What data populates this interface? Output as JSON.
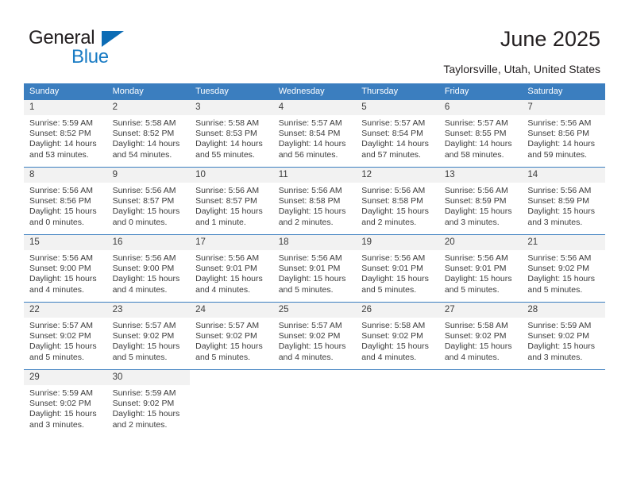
{
  "brand": {
    "name_top": "General",
    "name_bottom": "Blue",
    "accent_color": "#1a7cc4",
    "triangle_color": "#0c6cb5"
  },
  "header": {
    "title": "June 2025",
    "subtitle": "Taylorsville, Utah, United States",
    "header_bg": "#3b7ebf",
    "header_text_color": "#ffffff",
    "daynum_bg": "#f2f2f2"
  },
  "weekdays": [
    "Sunday",
    "Monday",
    "Tuesday",
    "Wednesday",
    "Thursday",
    "Friday",
    "Saturday"
  ],
  "weeks": [
    [
      {
        "day": "1",
        "sunrise": "Sunrise: 5:59 AM",
        "sunset": "Sunset: 8:52 PM",
        "daylight": "Daylight: 14 hours and 53 minutes."
      },
      {
        "day": "2",
        "sunrise": "Sunrise: 5:58 AM",
        "sunset": "Sunset: 8:52 PM",
        "daylight": "Daylight: 14 hours and 54 minutes."
      },
      {
        "day": "3",
        "sunrise": "Sunrise: 5:58 AM",
        "sunset": "Sunset: 8:53 PM",
        "daylight": "Daylight: 14 hours and 55 minutes."
      },
      {
        "day": "4",
        "sunrise": "Sunrise: 5:57 AM",
        "sunset": "Sunset: 8:54 PM",
        "daylight": "Daylight: 14 hours and 56 minutes."
      },
      {
        "day": "5",
        "sunrise": "Sunrise: 5:57 AM",
        "sunset": "Sunset: 8:54 PM",
        "daylight": "Daylight: 14 hours and 57 minutes."
      },
      {
        "day": "6",
        "sunrise": "Sunrise: 5:57 AM",
        "sunset": "Sunset: 8:55 PM",
        "daylight": "Daylight: 14 hours and 58 minutes."
      },
      {
        "day": "7",
        "sunrise": "Sunrise: 5:56 AM",
        "sunset": "Sunset: 8:56 PM",
        "daylight": "Daylight: 14 hours and 59 minutes."
      }
    ],
    [
      {
        "day": "8",
        "sunrise": "Sunrise: 5:56 AM",
        "sunset": "Sunset: 8:56 PM",
        "daylight": "Daylight: 15 hours and 0 minutes."
      },
      {
        "day": "9",
        "sunrise": "Sunrise: 5:56 AM",
        "sunset": "Sunset: 8:57 PM",
        "daylight": "Daylight: 15 hours and 0 minutes."
      },
      {
        "day": "10",
        "sunrise": "Sunrise: 5:56 AM",
        "sunset": "Sunset: 8:57 PM",
        "daylight": "Daylight: 15 hours and 1 minute."
      },
      {
        "day": "11",
        "sunrise": "Sunrise: 5:56 AM",
        "sunset": "Sunset: 8:58 PM",
        "daylight": "Daylight: 15 hours and 2 minutes."
      },
      {
        "day": "12",
        "sunrise": "Sunrise: 5:56 AM",
        "sunset": "Sunset: 8:58 PM",
        "daylight": "Daylight: 15 hours and 2 minutes."
      },
      {
        "day": "13",
        "sunrise": "Sunrise: 5:56 AM",
        "sunset": "Sunset: 8:59 PM",
        "daylight": "Daylight: 15 hours and 3 minutes."
      },
      {
        "day": "14",
        "sunrise": "Sunrise: 5:56 AM",
        "sunset": "Sunset: 8:59 PM",
        "daylight": "Daylight: 15 hours and 3 minutes."
      }
    ],
    [
      {
        "day": "15",
        "sunrise": "Sunrise: 5:56 AM",
        "sunset": "Sunset: 9:00 PM",
        "daylight": "Daylight: 15 hours and 4 minutes."
      },
      {
        "day": "16",
        "sunrise": "Sunrise: 5:56 AM",
        "sunset": "Sunset: 9:00 PM",
        "daylight": "Daylight: 15 hours and 4 minutes."
      },
      {
        "day": "17",
        "sunrise": "Sunrise: 5:56 AM",
        "sunset": "Sunset: 9:01 PM",
        "daylight": "Daylight: 15 hours and 4 minutes."
      },
      {
        "day": "18",
        "sunrise": "Sunrise: 5:56 AM",
        "sunset": "Sunset: 9:01 PM",
        "daylight": "Daylight: 15 hours and 5 minutes."
      },
      {
        "day": "19",
        "sunrise": "Sunrise: 5:56 AM",
        "sunset": "Sunset: 9:01 PM",
        "daylight": "Daylight: 15 hours and 5 minutes."
      },
      {
        "day": "20",
        "sunrise": "Sunrise: 5:56 AM",
        "sunset": "Sunset: 9:01 PM",
        "daylight": "Daylight: 15 hours and 5 minutes."
      },
      {
        "day": "21",
        "sunrise": "Sunrise: 5:56 AM",
        "sunset": "Sunset: 9:02 PM",
        "daylight": "Daylight: 15 hours and 5 minutes."
      }
    ],
    [
      {
        "day": "22",
        "sunrise": "Sunrise: 5:57 AM",
        "sunset": "Sunset: 9:02 PM",
        "daylight": "Daylight: 15 hours and 5 minutes."
      },
      {
        "day": "23",
        "sunrise": "Sunrise: 5:57 AM",
        "sunset": "Sunset: 9:02 PM",
        "daylight": "Daylight: 15 hours and 5 minutes."
      },
      {
        "day": "24",
        "sunrise": "Sunrise: 5:57 AM",
        "sunset": "Sunset: 9:02 PM",
        "daylight": "Daylight: 15 hours and 5 minutes."
      },
      {
        "day": "25",
        "sunrise": "Sunrise: 5:57 AM",
        "sunset": "Sunset: 9:02 PM",
        "daylight": "Daylight: 15 hours and 4 minutes."
      },
      {
        "day": "26",
        "sunrise": "Sunrise: 5:58 AM",
        "sunset": "Sunset: 9:02 PM",
        "daylight": "Daylight: 15 hours and 4 minutes."
      },
      {
        "day": "27",
        "sunrise": "Sunrise: 5:58 AM",
        "sunset": "Sunset: 9:02 PM",
        "daylight": "Daylight: 15 hours and 4 minutes."
      },
      {
        "day": "28",
        "sunrise": "Sunrise: 5:59 AM",
        "sunset": "Sunset: 9:02 PM",
        "daylight": "Daylight: 15 hours and 3 minutes."
      }
    ],
    [
      {
        "day": "29",
        "sunrise": "Sunrise: 5:59 AM",
        "sunset": "Sunset: 9:02 PM",
        "daylight": "Daylight: 15 hours and 3 minutes."
      },
      {
        "day": "30",
        "sunrise": "Sunrise: 5:59 AM",
        "sunset": "Sunset: 9:02 PM",
        "daylight": "Daylight: 15 hours and 2 minutes."
      },
      {
        "day": "",
        "sunrise": "",
        "sunset": "",
        "daylight": ""
      },
      {
        "day": "",
        "sunrise": "",
        "sunset": "",
        "daylight": ""
      },
      {
        "day": "",
        "sunrise": "",
        "sunset": "",
        "daylight": ""
      },
      {
        "day": "",
        "sunrise": "",
        "sunset": "",
        "daylight": ""
      },
      {
        "day": "",
        "sunrise": "",
        "sunset": "",
        "daylight": ""
      }
    ]
  ]
}
